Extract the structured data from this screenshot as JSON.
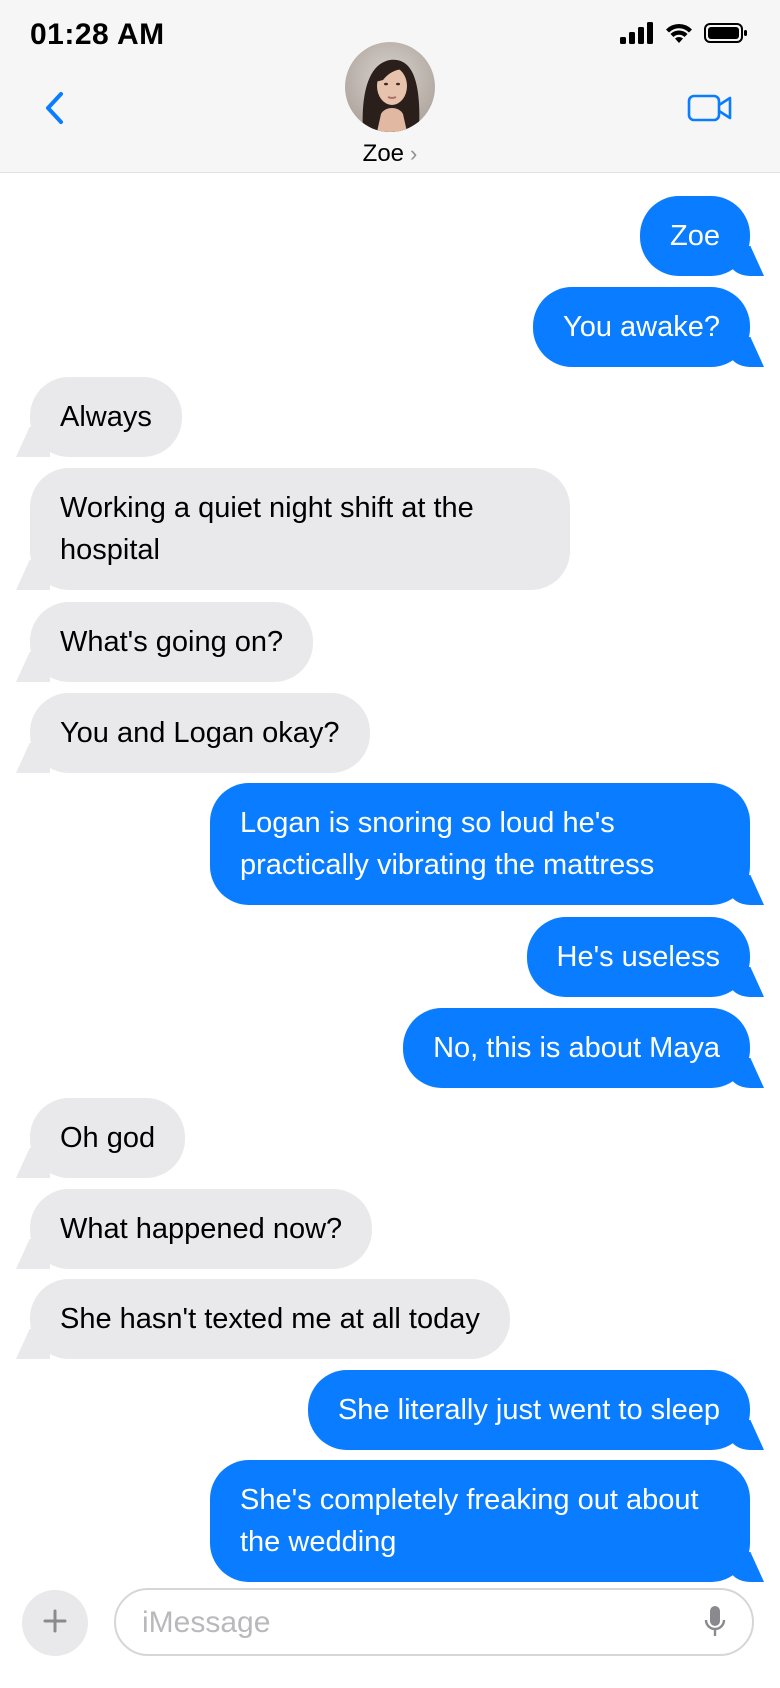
{
  "status_bar": {
    "time": "01:28 AM"
  },
  "header": {
    "contact_name": "Zoe",
    "chevron": "›",
    "avatar_icon": "avatar-photo",
    "back_icon": "chevron-left-icon",
    "video_icon": "video-camera-icon"
  },
  "colors": {
    "sent_bubble": "#0a7cff",
    "received_bubble": "#e9e9eb",
    "accent": "#0a7cff"
  },
  "messages": [
    {
      "from": "me",
      "text": "Zoe"
    },
    {
      "from": "me",
      "text": "You awake?"
    },
    {
      "from": "them",
      "text": "Always"
    },
    {
      "from": "them",
      "text": "Working a quiet night shift at the hospital"
    },
    {
      "from": "them",
      "text": "What's going on?"
    },
    {
      "from": "them",
      "text": "You and Logan okay?"
    },
    {
      "from": "me",
      "text": "Logan is snoring so loud he's practically vibrating the mattress"
    },
    {
      "from": "me",
      "text": "He's useless"
    },
    {
      "from": "me",
      "text": "No, this is about Maya"
    },
    {
      "from": "them",
      "text": "Oh god"
    },
    {
      "from": "them",
      "text": "What happened now?"
    },
    {
      "from": "them",
      "text": "She hasn't texted me at all today"
    },
    {
      "from": "me",
      "text": "She literally just went to sleep"
    },
    {
      "from": "me",
      "text": "She's completely freaking out about the wedding"
    }
  ],
  "composer": {
    "placeholder": "iMessage",
    "value": "",
    "plus_icon": "plus-icon",
    "mic_icon": "microphone-icon"
  }
}
